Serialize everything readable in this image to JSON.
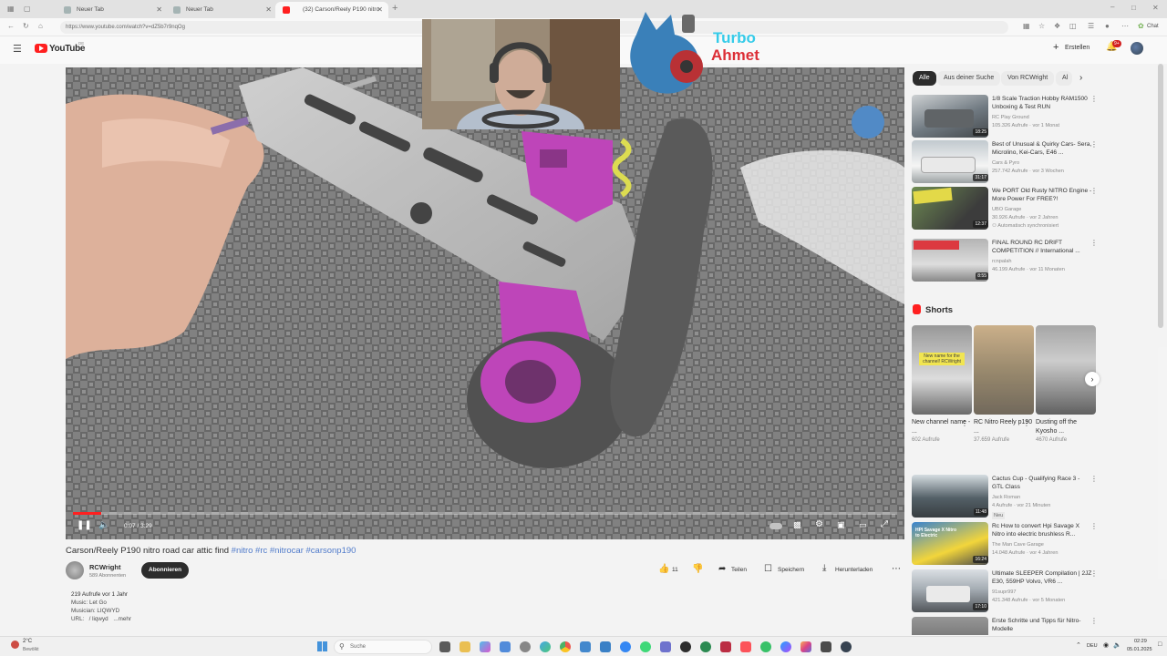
{
  "browser": {
    "tabs": [
      {
        "label": "Neuer Tab"
      },
      {
        "label": "Neuer Tab"
      },
      {
        "label": "(32) Carson/Reely P190 nitro"
      }
    ],
    "url": "https://www.youtube.com/watch?v=dZ5b7r9nqOg",
    "profile_label": "Chat"
  },
  "youtube": {
    "logo_text": "YouTube",
    "logo_region": "DE",
    "create_label": "Erstellen",
    "notifications_count": "9+"
  },
  "overlay": {
    "streamer_line1": "Turbo",
    "streamer_line2": "Ahmet"
  },
  "player": {
    "time": "0:07 / 3:29",
    "progress_fraction": 0.034
  },
  "video": {
    "title_prefix": "Carson/Reely P190 nitro road car attic find",
    "hashtags": "#nitro #rc #nitrocar #carsonp190",
    "channel": "RCWright",
    "subscribers": "589 Abonnenten",
    "subscribe_label": "Abonnieren",
    "likes": "11",
    "share_label": "Teilen",
    "save_label": "Speichern",
    "download_label": "Herunterladen",
    "description": {
      "stats": "219 Aufrufe  vor 1 Jahr",
      "line1": "Music: Let Go",
      "line2": "Musician: LIQWYD",
      "line3": "URL:   / liqwyd",
      "more": "...mehr"
    }
  },
  "sidebar": {
    "chips": [
      {
        "label": "Alle"
      },
      {
        "label": "Aus deiner Suche"
      },
      {
        "label": "Von RCWright"
      },
      {
        "label": "Al"
      }
    ],
    "recommendations_top": [
      {
        "title": "1/8 Scale Traction Hobby RAM1500 Unboxing & Test RUN",
        "channel": "RC Play Ground",
        "meta": "105.326 Aufrufe · vor 1 Monat",
        "duration": "18:25"
      },
      {
        "title": "Best of Unusual & Quirky Cars- Sera, Microlino, Kei-Cars, E46 ...",
        "channel": "Cars & Pyro",
        "meta": "257.742 Aufrufe · vor 3 Wochen",
        "duration": "31:17"
      },
      {
        "title": "We PORT Old Rusty NITRO Engine - More Power For FREE?!",
        "channel": "UBO Garage",
        "meta": "30.926 Aufrufe · vor 2 Jahren",
        "extra": "Automatisch synchronisiert",
        "duration": "12:37"
      },
      {
        "title": "FINAL ROUND RC DRIFT COMPETITION // International ...",
        "channel": "rcnpalah",
        "meta": "46.199 Aufrufe · vor 11 Monaten",
        "duration": "8:55"
      }
    ],
    "shorts_heading": "Shorts",
    "shorts": [
      {
        "title": "New channel name - ...",
        "views": "602 Aufrufe",
        "overlay": "New name for the channel! RCWright"
      },
      {
        "title": "RC Nitro Reely p190 ...",
        "views": "37.659 Aufrufe"
      },
      {
        "title": "Dusting off the Kyosho ...",
        "views": "4670 Aufrufe"
      }
    ],
    "recommendations_bottom": [
      {
        "title": "Cactus Cup - Qualifying Race 3 - GTL Class",
        "channel": "Jack Roman",
        "meta": "4 Aufrufe · vor 21 Minuten",
        "badge": "Neu",
        "duration": "11:48"
      },
      {
        "title": "Rc How to convert Hpi Savage X Nitro into electric brushless R...",
        "channel": "The Man Cave Garage",
        "meta": "14.048 Aufrufe · vor 4 Jahren",
        "duration": "16:24",
        "overlay": "HPI Savage X Nitro to Electric"
      },
      {
        "title": "Ultimate SLEEPER Compilation | 2JZ E30, 559HP Volvo, VR6 ...",
        "channel": "91supr997",
        "meta": "421.348 Aufrufe · vor 5 Monaten",
        "duration": "17:10"
      },
      {
        "title": "Erste Schritte und Tipps für Nitro-Modelle",
        "channel": "",
        "meta": "",
        "duration": ""
      }
    ]
  },
  "taskbar": {
    "weather_temp": "2°C",
    "weather_desc": "Bewölkt",
    "search_placeholder": "Suche",
    "lang": "DEU",
    "time": "02:29",
    "date": "05.01.2025"
  },
  "colors": {
    "yt_red": "#ff0000",
    "link_blue": "#3a6ac4",
    "chip_active": "#0f0f0f",
    "purple_parts": "#b52cb0"
  }
}
